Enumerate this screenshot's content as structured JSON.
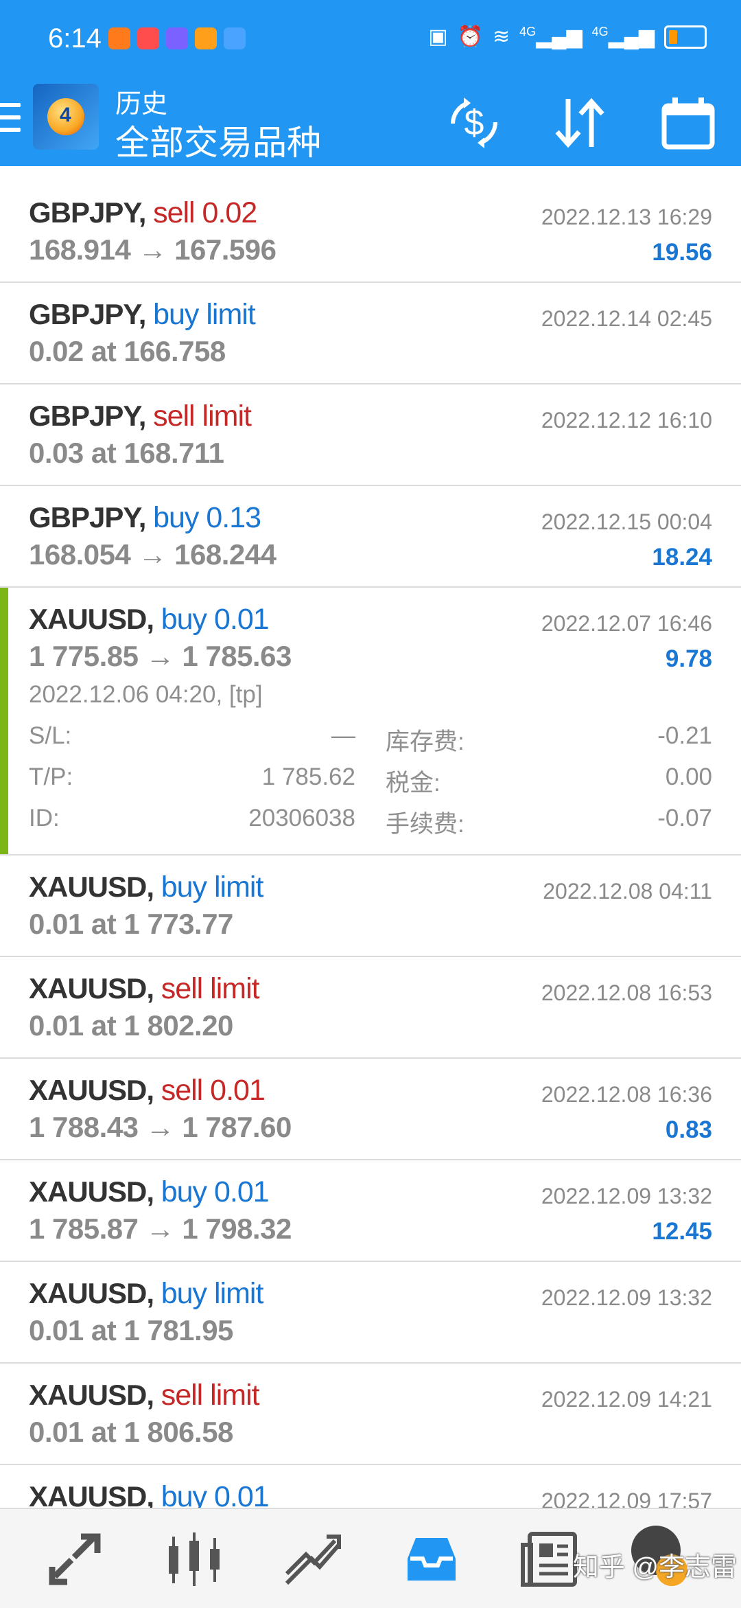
{
  "status_bar": {
    "time": "6:14",
    "signal1": "4G",
    "signal2": "4G"
  },
  "appbar": {
    "title": "历史",
    "subtitle": "全部交易品种",
    "actions": [
      "currency-exchange-icon",
      "sort-icon",
      "calendar-icon"
    ]
  },
  "trades": [
    {
      "symbol": "GBPJPY,",
      "side": "sell 0.02",
      "side_type": "sell",
      "price": "168.914 → 167.596",
      "date": "2022.12.13 16:29",
      "profit": "19.56"
    },
    {
      "symbol": "GBPJPY,",
      "side": "buy limit",
      "side_type": "buy",
      "price": "0.02 at 166.758",
      "date": "2022.12.14 02:45",
      "profit": ""
    },
    {
      "symbol": "GBPJPY,",
      "side": "sell limit",
      "side_type": "sell",
      "price": "0.03 at 168.711",
      "date": "2022.12.12 16:10",
      "profit": ""
    },
    {
      "symbol": "GBPJPY,",
      "side": "buy 0.13",
      "side_type": "buy",
      "price": "168.054 → 168.244",
      "date": "2022.12.15 00:04",
      "profit": "18.24"
    },
    {
      "symbol": "XAUUSD,",
      "side": "buy 0.01",
      "side_type": "buy",
      "price": "1 775.85 → 1 785.63",
      "date": "2022.12.07 16:46",
      "profit": "9.78"
    },
    {
      "symbol": "XAUUSD,",
      "side": "buy limit",
      "side_type": "buy",
      "price": "0.01 at 1 773.77",
      "date": "2022.12.08 04:11",
      "profit": ""
    },
    {
      "symbol": "XAUUSD,",
      "side": "sell limit",
      "side_type": "sell",
      "price": "0.01 at 1 802.20",
      "date": "2022.12.08 16:53",
      "profit": ""
    },
    {
      "symbol": "XAUUSD,",
      "side": "sell 0.01",
      "side_type": "sell",
      "price": "1 788.43 → 1 787.60",
      "date": "2022.12.08 16:36",
      "profit": "0.83"
    },
    {
      "symbol": "XAUUSD,",
      "side": "buy 0.01",
      "side_type": "buy",
      "price": "1 785.87 → 1 798.32",
      "date": "2022.12.09 13:32",
      "profit": "12.45"
    },
    {
      "symbol": "XAUUSD,",
      "side": "buy limit",
      "side_type": "buy",
      "price": "0.01 at 1 781.95",
      "date": "2022.12.09 13:32",
      "profit": ""
    },
    {
      "symbol": "XAUUSD,",
      "side": "sell limit",
      "side_type": "sell",
      "price": "0.01 at 1 806.58",
      "date": "2022.12.09 14:21",
      "profit": ""
    },
    {
      "symbol": "XAUUSD,",
      "side": "buy 0.01",
      "side_type": "buy",
      "price": "",
      "date": "2022.12.09 17:57",
      "profit": ""
    }
  ],
  "expanded_detail": {
    "open_info": "2022.12.06 04:20, [tp]",
    "sl_label": "S/L:",
    "sl_value": "—",
    "tp_label": "T/P:",
    "tp_value": "1 785.62",
    "id_label": "ID:",
    "id_value": "20306038",
    "swap_label": "库存费:",
    "swap_value": "-0.21",
    "tax_label": "税金:",
    "tax_value": "0.00",
    "fee_label": "手续费:",
    "fee_value": "-0.07"
  },
  "bottom_nav": [
    {
      "name": "quotes-icon"
    },
    {
      "name": "chart-icon"
    },
    {
      "name": "trade-icon"
    },
    {
      "name": "history-icon",
      "active": true
    },
    {
      "name": "news-icon"
    }
  ],
  "watermark": "知乎 @李志雷",
  "colors": {
    "primary": "#2196f3",
    "sell": "#c62828",
    "buy": "#1976d2",
    "expanded_bar": "#7cb518"
  }
}
